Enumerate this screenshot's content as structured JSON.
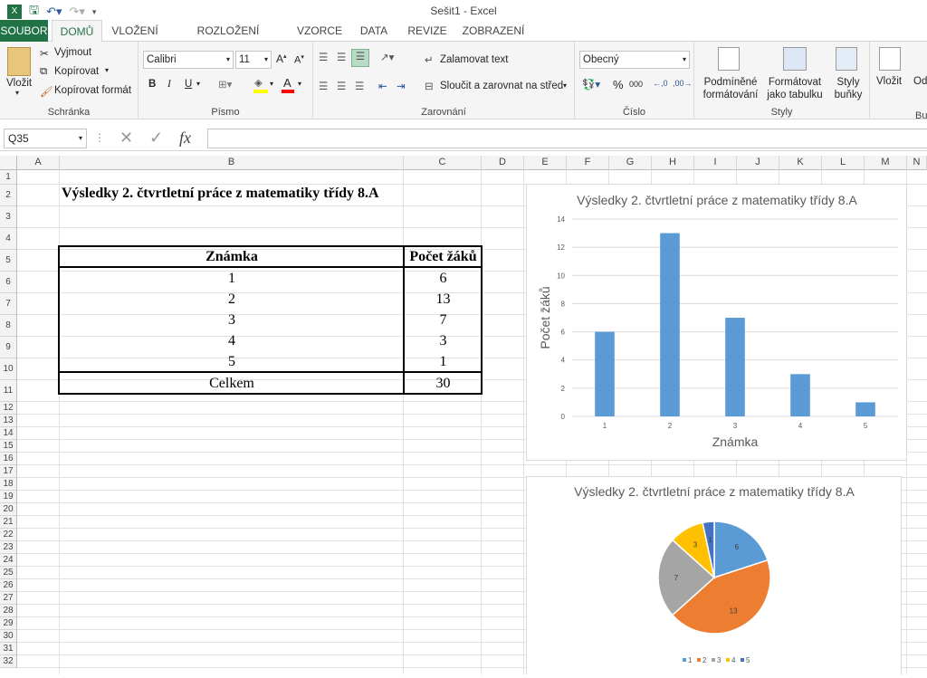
{
  "window": {
    "title": "Sešit1 - Excel"
  },
  "tabs": [
    "SOUBOR",
    "DOMŮ",
    "VLOŽENÍ",
    "ROZLOŽENÍ STRÁNKY",
    "VZORCE",
    "DATA",
    "REVIZE",
    "ZOBRAZENÍ"
  ],
  "ribbon": {
    "clipboard": {
      "paste": "Vložit",
      "cut": "Vyjmout",
      "copy": "Kopírovat",
      "format_painter": "Kopírovat formát",
      "label": "Schránka"
    },
    "font": {
      "name": "Calibri",
      "size": "11",
      "bold": "B",
      "italic": "I",
      "underline": "U",
      "label": "Písmo"
    },
    "alignment": {
      "wrap": "Zalamovat text",
      "merge": "Sloučit a zarovnat na střed",
      "label": "Zarovnání"
    },
    "number": {
      "format": "Obecný",
      "label": "Číslo"
    },
    "styles": {
      "conditional": "Podmíněné formátování",
      "table": "Formátovat jako tabulku",
      "cell": "Styly buňky",
      "label": "Styly"
    },
    "cells": {
      "insert": "Vložit",
      "delete": "Odst",
      "label": "Bu"
    }
  },
  "formula_bar": {
    "name_box": "Q35",
    "fx": "fx",
    "value": ""
  },
  "columns": [
    "A",
    "B",
    "C",
    "D",
    "E",
    "F",
    "G",
    "H",
    "I",
    "J",
    "K",
    "L",
    "M",
    "N"
  ],
  "rows": [
    "1",
    "2",
    "3",
    "4",
    "5",
    "6",
    "7",
    "8",
    "9",
    "10",
    "11",
    "12",
    "13",
    "14",
    "15",
    "16",
    "17",
    "18",
    "19",
    "20",
    "21",
    "22",
    "23",
    "24",
    "25",
    "26",
    "27",
    "28",
    "29",
    "30",
    "31",
    "32"
  ],
  "sheet": {
    "title": "Výsledky 2. čtvrtletní práce z matematiky třídy 8.A",
    "header": [
      "Známka",
      "Počet žáků"
    ],
    "rows": [
      [
        "1",
        "6"
      ],
      [
        "2",
        "13"
      ],
      [
        "3",
        "7"
      ],
      [
        "4",
        "3"
      ],
      [
        "5",
        "1"
      ]
    ],
    "total": [
      "Celkem",
      "30"
    ]
  },
  "chart_data": [
    {
      "type": "bar",
      "title": "Výsledky 2. čtvrtletní práce z matematiky třídy 8.A",
      "categories": [
        "1",
        "2",
        "3",
        "4",
        "5"
      ],
      "values": [
        6,
        13,
        7,
        3,
        1
      ],
      "xlabel": "Známka",
      "ylabel": "Počet žáků",
      "ylim": [
        0,
        14
      ],
      "yticks": [
        "0",
        "2",
        "4",
        "6",
        "8",
        "10",
        "12",
        "14"
      ],
      "color": "#5b9bd5",
      "grid": true
    },
    {
      "type": "pie",
      "title": "Výsledky 2. čtvrtletní práce z matematiky třídy 8.A",
      "categories": [
        "1",
        "2",
        "3",
        "4",
        "5"
      ],
      "values": [
        6,
        13,
        7,
        3,
        1
      ],
      "data_labels": [
        "6",
        "13",
        "7",
        "3",
        "1"
      ],
      "colors": [
        "#5b9bd5",
        "#ed7d31",
        "#a5a5a5",
        "#ffc000",
        "#4472c4"
      ],
      "legend": "bottom"
    }
  ]
}
